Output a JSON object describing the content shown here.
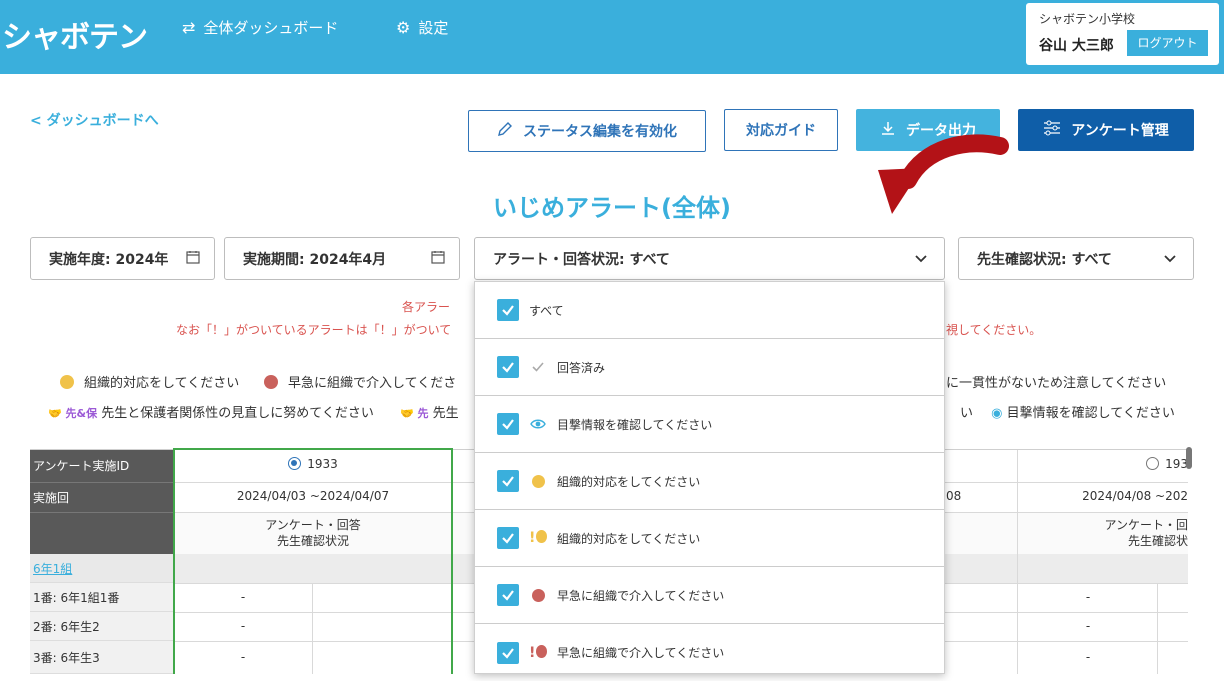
{
  "header": {
    "logo": "シャボテン",
    "nav": [
      {
        "label": "全体ダッシュボード",
        "icon": "refresh-icon"
      },
      {
        "label": "設定",
        "icon": "gear-icon"
      }
    ],
    "school": "シャボテン小学校",
    "user": "谷山 大三郎",
    "logout": "ログアウト"
  },
  "actions": {
    "back": "< ダッシュボードへ",
    "status_edit": "ステータス編集を有効化",
    "guide": "対応ガイド",
    "export": "データ出力",
    "survey_manage": "アンケート管理"
  },
  "page_title": "いじめアラート(全体)",
  "filters": {
    "year": "実施年度: 2024年",
    "period": "実施期間: 2024年4月",
    "alert_status": "アラート・回答状況: すべて",
    "teacher_status": "先生確認状況: すべて"
  },
  "notices": {
    "line1": "各アラー",
    "line2_left": "なお「！」がついているアラートは「！」がついて",
    "line2_right": "視してください。"
  },
  "legend": {
    "organized": "組織的対応をしてください",
    "urgent": "早急に組織で介入してくださ",
    "inconsistent": "に一貫性がないため注意してください",
    "tag_tp": "先&保",
    "tag_tp_text": "先生と保護者関係性の見直しに努めてください",
    "tag_t": "先",
    "tag_t_text": "先生",
    "right_i": "い",
    "witness": "目撃情報を確認してください"
  },
  "colors": {
    "header": "#3aafdc",
    "yellow": "#f0c24a",
    "red": "#c9615c",
    "green_box": "#41a84a"
  },
  "table": {
    "label_survey_id": "アンケート実施ID",
    "label_round": "実施回",
    "class_name": "6年1組",
    "col1_id": "1933",
    "col1_range": "2024/04/03 ~2024/04/07",
    "col1_h1": "アンケート・回答",
    "col1_h2": "先生確認状況",
    "col3_id": "193",
    "col3_range": "2024/04/08 ~202",
    "col3_h1": "アンケート・回",
    "col3_h2": "先生確認状",
    "mid_range_tail": "08",
    "rows": [
      {
        "label": "1番: 6年1組1番",
        "v1": "-",
        "v3": "-"
      },
      {
        "label": "2番: 6年生2",
        "v1": "-",
        "v3": "-"
      },
      {
        "label": "3番: 6年生3",
        "v1": "-",
        "v3": "-"
      }
    ]
  },
  "dropdown": [
    {
      "label": "すべて",
      "icon": "none"
    },
    {
      "label": "回答済み",
      "icon": "check-icon"
    },
    {
      "label": "目撃情報を確認してください",
      "icon": "eye-icon"
    },
    {
      "label": "組織的対応をしてください",
      "icon": "yellow-dot-icon"
    },
    {
      "label": "組織的対応をしてください",
      "icon": "yellow-dot-alert-icon"
    },
    {
      "label": "早急に組織で介入してください",
      "icon": "red-dot-icon"
    },
    {
      "label": "早急に組織で介入してください",
      "icon": "red-dot-alert-icon"
    }
  ]
}
